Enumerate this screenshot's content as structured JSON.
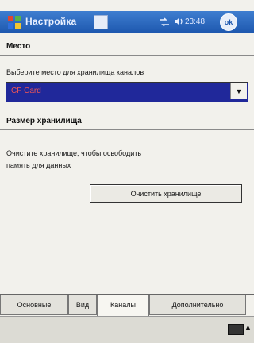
{
  "titlebar": {
    "title": "Настройка",
    "time": "23:48",
    "ok_label": "ok"
  },
  "place_section": {
    "header": "Место",
    "label": "Выберите место для хранилища каналов",
    "selected": "CF Card"
  },
  "size_section": {
    "header": "Размер хранилища",
    "description_line1": "Очистите хранилище, чтобы освободить",
    "description_line2": "память для данных",
    "clear_button": "Очистить хранилище"
  },
  "tabs": [
    {
      "label": "Основные",
      "active": false
    },
    {
      "label": "Вид",
      "active": false
    },
    {
      "label": "Каналы",
      "active": true
    },
    {
      "label": "Дополнительно",
      "active": false
    }
  ],
  "icons": {
    "start": "windows-flag-icon",
    "signal": "signal-icon",
    "volume": "volume-icon",
    "keyboard": "keyboard-icon"
  },
  "colors": {
    "titlebar": "#1d57ae",
    "selection": "#20289a",
    "selected_text": "#e55555"
  }
}
